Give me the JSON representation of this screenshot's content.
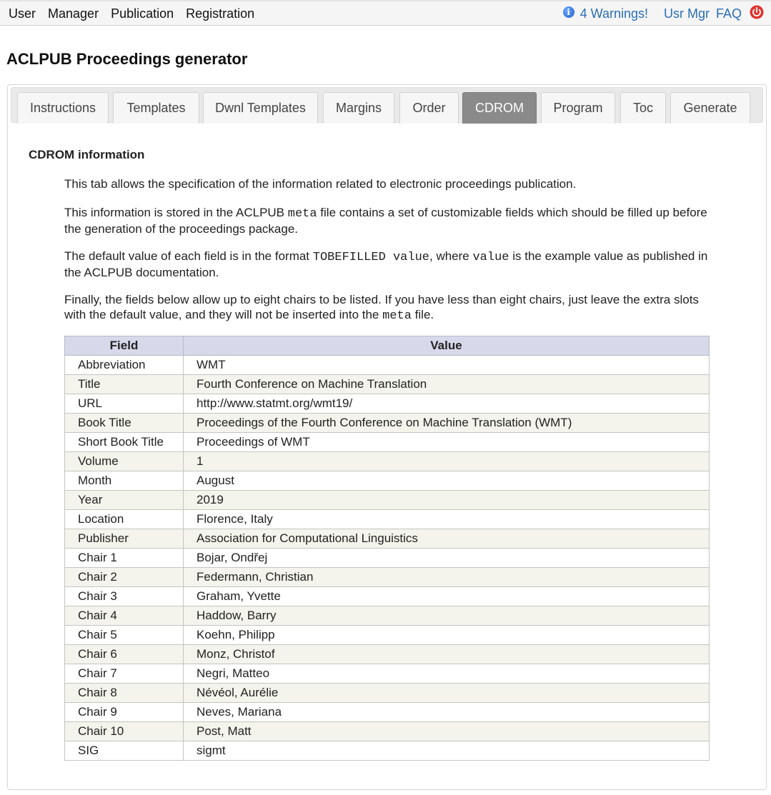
{
  "nav": {
    "menu": [
      "User",
      "Manager",
      "Publication",
      "Registration"
    ],
    "warnings": "4 Warnings!",
    "usr_mgr": "Usr Mgr",
    "faq": "FAQ"
  },
  "page_title": "ACLPUB Proceedings generator",
  "tabs": [
    {
      "label": "Instructions",
      "active": false
    },
    {
      "label": "Templates",
      "active": false
    },
    {
      "label": "Dwnl Templates",
      "active": false
    },
    {
      "label": "Margins",
      "active": false
    },
    {
      "label": "Order",
      "active": false
    },
    {
      "label": "CDROM",
      "active": true
    },
    {
      "label": "Program",
      "active": false
    },
    {
      "label": "Toc",
      "active": false
    },
    {
      "label": "Generate",
      "active": false
    }
  ],
  "section": {
    "title": "CDROM information",
    "p1": "This tab allows the specification of the information related to electronic proceedings publication.",
    "p2_a": "This information is stored in the ACLPUB ",
    "p2_code": "meta",
    "p2_b": " file contains a set of customizable fields which should be filled up before the generation of the proceedings package.",
    "p3_a": "The default value of each field is in the format ",
    "p3_code1": "TOBEFILLED value",
    "p3_b": ", where ",
    "p3_code2": "value",
    "p3_c": " is the example value as published in the ACLPUB documentation.",
    "p4_a": "Finally, the fields below allow up to eight chairs to be listed. If you have less than eight chairs, just leave the extra slots with the default value, and they will not be inserted into the ",
    "p4_code": "meta",
    "p4_b": " file."
  },
  "table": {
    "headers": [
      "Field",
      "Value"
    ],
    "rows": [
      [
        "Abbreviation",
        "WMT"
      ],
      [
        "Title",
        "Fourth Conference on Machine Translation"
      ],
      [
        "URL",
        "http://www.statmt.org/wmt19/"
      ],
      [
        "Book Title",
        "Proceedings of the Fourth Conference on Machine Translation (WMT)"
      ],
      [
        "Short Book Title",
        "Proceedings of WMT"
      ],
      [
        "Volume",
        "1"
      ],
      [
        "Month",
        "August"
      ],
      [
        "Year",
        "2019"
      ],
      [
        "Location",
        "Florence, Italy"
      ],
      [
        "Publisher",
        "Association for Computational Linguistics"
      ],
      [
        "Chair 1",
        "Bojar, Ondřej"
      ],
      [
        "Chair 2",
        "Federmann, Christian"
      ],
      [
        "Chair 3",
        "Graham, Yvette"
      ],
      [
        "Chair 4",
        "Haddow, Barry"
      ],
      [
        "Chair 5",
        "Koehn, Philipp"
      ],
      [
        "Chair 6",
        "Monz, Christof"
      ],
      [
        "Chair 7",
        "Negri, Matteo"
      ],
      [
        "Chair 8",
        "Névéol, Aurélie"
      ],
      [
        "Chair 9",
        "Neves, Mariana"
      ],
      [
        "Chair 10",
        "Post, Matt"
      ],
      [
        "SIG",
        "sigmt"
      ]
    ]
  }
}
